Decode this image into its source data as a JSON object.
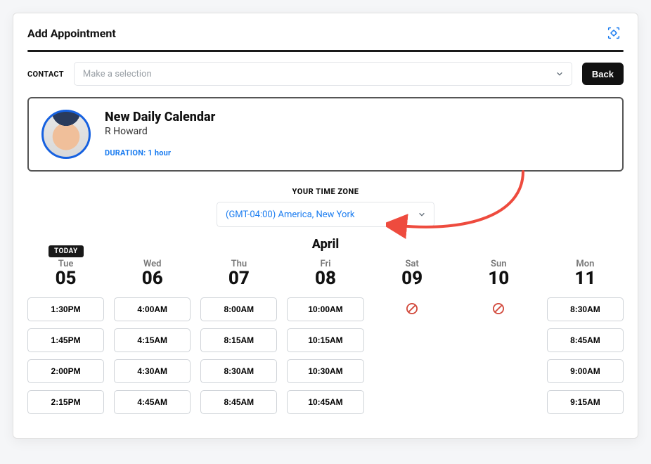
{
  "header": {
    "title": "Add Appointment"
  },
  "contact": {
    "label": "CONTACT",
    "placeholder": "Make a selection",
    "back_label": "Back"
  },
  "card": {
    "title": "New Daily Calendar",
    "subtitle": "R Howard",
    "duration": "DURATION: 1 hour"
  },
  "timezone": {
    "label": "YOUR TIME ZONE",
    "selected": "(GMT-04:00) America, New York"
  },
  "month": "April",
  "today_badge": "TODAY",
  "days": [
    {
      "name": "Tue",
      "num": "05",
      "today": true,
      "slots": [
        "1:30PM",
        "1:45PM",
        "2:00PM",
        "2:15PM"
      ]
    },
    {
      "name": "Wed",
      "num": "06",
      "slots": [
        "4:00AM",
        "4:15AM",
        "4:30AM",
        "4:45AM"
      ]
    },
    {
      "name": "Thu",
      "num": "07",
      "slots": [
        "8:00AM",
        "8:15AM",
        "8:30AM",
        "8:45AM"
      ]
    },
    {
      "name": "Fri",
      "num": "08",
      "slots": [
        "10:00AM",
        "10:15AM",
        "10:30AM",
        "10:45AM"
      ]
    },
    {
      "name": "Sat",
      "num": "09",
      "slots": []
    },
    {
      "name": "Sun",
      "num": "10",
      "slots": []
    },
    {
      "name": "Mon",
      "num": "11",
      "slots": [
        "8:30AM",
        "8:45AM",
        "9:00AM",
        "9:15AM"
      ]
    }
  ]
}
